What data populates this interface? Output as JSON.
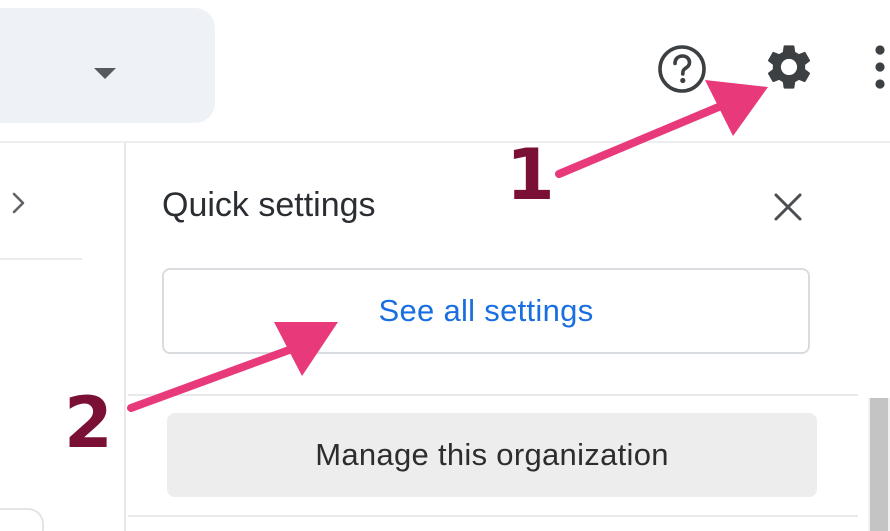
{
  "colors": {
    "link_blue": "#1a6fe0",
    "annotation_arrow": "#e8397a",
    "annotation_number": "#7a1036",
    "manage_button_bg": "#ededed"
  },
  "toolbar": {
    "help_icon": "help-circle-icon",
    "settings_icon": "gear-icon",
    "apps_icon": "apps-grid-icon",
    "search_dropdown_icon": "caret-down-icon"
  },
  "quick_settings": {
    "title": "Quick settings",
    "close_icon": "close-icon",
    "see_all_label": "See all settings",
    "manage_label": "Manage this organization"
  },
  "annotations": {
    "step_1": "1",
    "step_2": "2"
  }
}
